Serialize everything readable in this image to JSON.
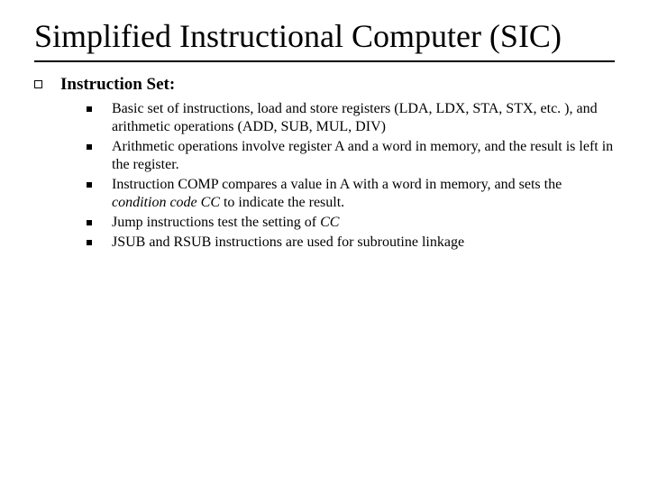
{
  "title": "Simplified Instructional Computer (SIC)",
  "section": {
    "heading": "Instruction Set:",
    "items": [
      {
        "pre": "Basic set of instructions, load and store registers (LDA, LDX, STA, STX, etc. ), and arithmetic operations (ADD, SUB, MUL, DIV)",
        "italic": "",
        "post": ""
      },
      {
        "pre": "Arithmetic operations involve register A and a word in memory, and the result is left in the register.",
        "italic": "",
        "post": ""
      },
      {
        "pre": "Instruction COMP compares a value in A with a word in memory, and sets the ",
        "italic": "condition code CC",
        "post": " to indicate the result."
      },
      {
        "pre": "Jump instructions test the setting of ",
        "italic": "CC",
        "post": ""
      },
      {
        "pre": "JSUB and RSUB instructions are used for subroutine linkage",
        "italic": "",
        "post": ""
      }
    ]
  }
}
